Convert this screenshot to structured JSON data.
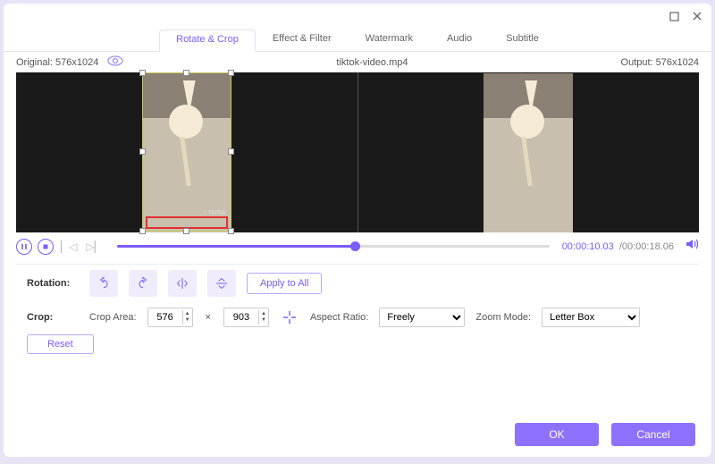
{
  "titlebar": {},
  "tabs": [
    "Rotate & Crop",
    "Effect & Filter",
    "Watermark",
    "Audio",
    "Subtitle"
  ],
  "active_tab_index": 0,
  "info": {
    "original": "Original: 576x1024",
    "filename": "tiktok-video.mp4",
    "output": "Output: 576x1024"
  },
  "playback": {
    "current": "00:00:10.03",
    "total": "00:00:18.06",
    "progress_percent": 55
  },
  "rotation": {
    "label": "Rotation:",
    "apply_all": "Apply to All",
    "buttons": [
      "rotate-left",
      "rotate-right",
      "flip-h",
      "flip-v"
    ]
  },
  "crop": {
    "label": "Crop:",
    "area_label": "Crop Area:",
    "width": "576",
    "height": "903",
    "aspect_label": "Aspect Ratio:",
    "aspect_value": "Freely",
    "zoom_label": "Zoom Mode:",
    "zoom_value": "Letter Box",
    "reset": "Reset"
  },
  "footer": {
    "ok": "OK",
    "cancel": "Cancel"
  }
}
